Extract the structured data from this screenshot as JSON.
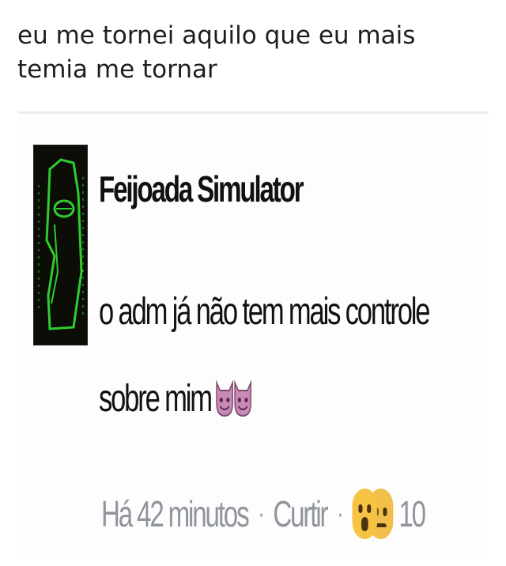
{
  "post": {
    "text": "eu me tornei aquilo que eu mais temia me tornar"
  },
  "comment": {
    "author": "Feijoada Simulator",
    "body": "o adm já não tem mais controle sobre mim",
    "emoji": [
      "smiling-imp-emoji",
      "smiling-imp-emoji"
    ],
    "time": "Há 42 minutos",
    "like_label": "Curtir",
    "separator": "·",
    "reactions": [
      "wow-reaction-icon",
      "sad-reaction-icon"
    ],
    "reaction_count": "10"
  },
  "colors": {
    "text": "#1c1e21",
    "meta": "#90949c",
    "avatar_bg": "#0b0d06",
    "avatar_fg": "#2ecc2e",
    "devil": "#c98ab5"
  }
}
